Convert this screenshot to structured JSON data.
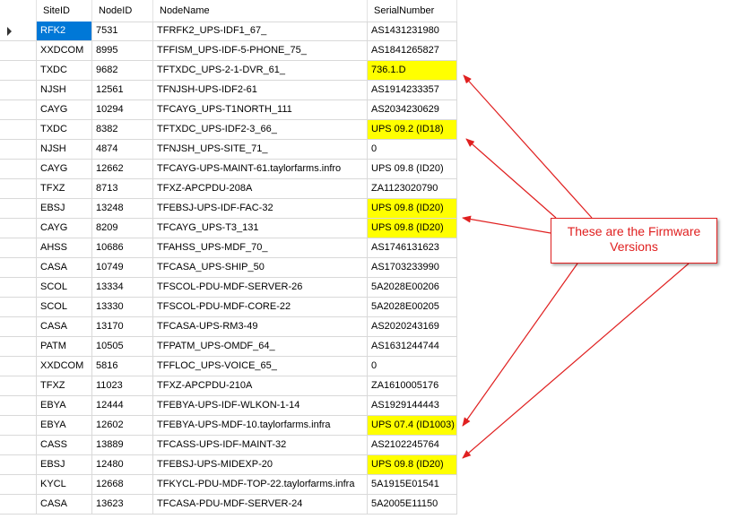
{
  "columns": [
    "SiteID",
    "NodeID",
    "NodeName",
    "SerialNumber"
  ],
  "rows": [
    {
      "site": "RFK2",
      "node": "7531",
      "name": "TFRFK2_UPS-IDF1_67_",
      "serial": "AS1431231980",
      "hl": false,
      "sel": true
    },
    {
      "site": "XXDCOM",
      "node": "8995",
      "name": "TFFISM_UPS-IDF-5-PHONE_75_",
      "serial": "AS1841265827",
      "hl": false
    },
    {
      "site": "TXDC",
      "node": "9682",
      "name": "TFTXDC_UPS-2-1-DVR_61_",
      "serial": "736.1.D",
      "hl": true
    },
    {
      "site": "NJSH",
      "node": "12561",
      "name": "TFNJSH-UPS-IDF2-61",
      "serial": "AS1914233357",
      "hl": false
    },
    {
      "site": "CAYG",
      "node": "10294",
      "name": "TFCAYG_UPS-T1NORTH_111",
      "serial": "AS2034230629",
      "hl": false
    },
    {
      "site": "TXDC",
      "node": "8382",
      "name": "TFTXDC_UPS-IDF2-3_66_",
      "serial": "UPS 09.2 (ID18)",
      "hl": true
    },
    {
      "site": "NJSH",
      "node": "4874",
      "name": "TFNJSH_UPS-SITE_71_",
      "serial": "0",
      "hl": false
    },
    {
      "site": "CAYG",
      "node": "12662",
      "name": "TFCAYG-UPS-MAINT-61.taylorfarms.infro",
      "serial": "UPS 09.8 (ID20)",
      "hl": false
    },
    {
      "site": "TFXZ",
      "node": "8713",
      "name": "TFXZ-APCPDU-208A",
      "serial": "ZA1123020790",
      "hl": false
    },
    {
      "site": "EBSJ",
      "node": "13248",
      "name": "TFEBSJ-UPS-IDF-FAC-32",
      "serial": "UPS 09.8 (ID20)",
      "hl": true
    },
    {
      "site": "CAYG",
      "node": "8209",
      "name": "TFCAYG_UPS-T3_131",
      "serial": "UPS 09.8 (ID20)",
      "hl": true
    },
    {
      "site": "AHSS",
      "node": "10686",
      "name": "TFAHSS_UPS-MDF_70_",
      "serial": "AS1746131623",
      "hl": false
    },
    {
      "site": "CASA",
      "node": "10749",
      "name": "TFCASA_UPS-SHIP_50",
      "serial": "AS1703233990",
      "hl": false
    },
    {
      "site": "SCOL",
      "node": "13334",
      "name": "TFSCOL-PDU-MDF-SERVER-26",
      "serial": "5A2028E00206",
      "hl": false
    },
    {
      "site": "SCOL",
      "node": "13330",
      "name": "TFSCOL-PDU-MDF-CORE-22",
      "serial": "5A2028E00205",
      "hl": false
    },
    {
      "site": "CASA",
      "node": "13170",
      "name": "TFCASA-UPS-RM3-49",
      "serial": "AS2020243169",
      "hl": false
    },
    {
      "site": "PATM",
      "node": "10505",
      "name": "TFPATM_UPS-OMDF_64_",
      "serial": "AS1631244744",
      "hl": false
    },
    {
      "site": "XXDCOM",
      "node": "5816",
      "name": "TFFLOC_UPS-VOICE_65_",
      "serial": "0",
      "hl": false
    },
    {
      "site": "TFXZ",
      "node": "11023",
      "name": "TFXZ-APCPDU-210A",
      "serial": "ZA1610005176",
      "hl": false
    },
    {
      "site": "EBYA",
      "node": "12444",
      "name": "TFEBYA-UPS-IDF-WLKON-1-14",
      "serial": "AS1929144443",
      "hl": false
    },
    {
      "site": "EBYA",
      "node": "12602",
      "name": "TFEBYA-UPS-MDF-10.taylorfarms.infra",
      "serial": "UPS 07.4 (ID1003)",
      "hl": true
    },
    {
      "site": "CASS",
      "node": "13889",
      "name": "TFCASS-UPS-IDF-MAINT-32",
      "serial": "AS2102245764",
      "hl": false
    },
    {
      "site": "EBSJ",
      "node": "12480",
      "name": "TFEBSJ-UPS-MIDEXP-20",
      "serial": "UPS 09.8 (ID20)",
      "hl": true
    },
    {
      "site": "KYCL",
      "node": "12668",
      "name": "TFKYCL-PDU-MDF-TOP-22.taylorfarms.infra",
      "serial": "5A1915E01541",
      "hl": false
    },
    {
      "site": "CASA",
      "node": "13623",
      "name": "TFCASA-PDU-MDF-SERVER-24",
      "serial": "5A2005E11150",
      "hl": false
    }
  ],
  "callout": {
    "line1": "These are the Firmware",
    "line2": "Versions"
  },
  "colors": {
    "highlight": "#ffff00",
    "annotation": "#e02020",
    "selection": "#0078d7"
  }
}
